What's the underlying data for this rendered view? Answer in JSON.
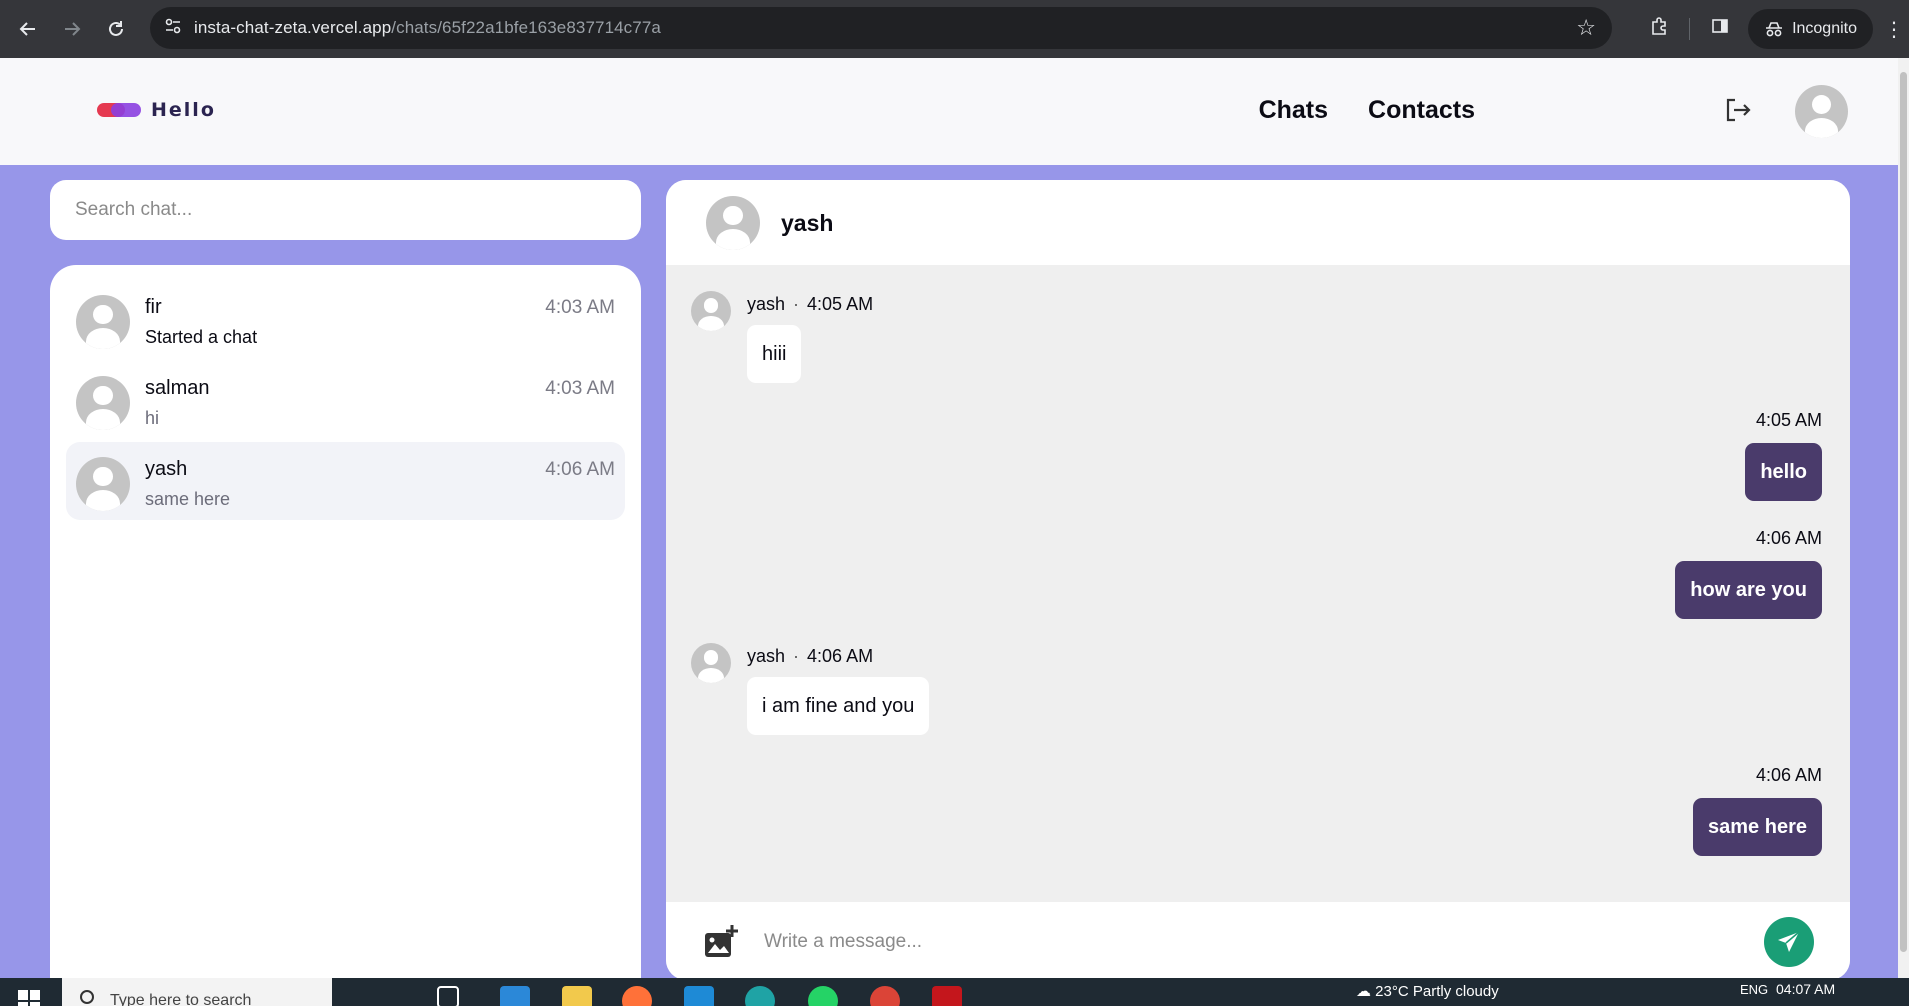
{
  "browser": {
    "url_host": "insta-chat-zeta.vercel.app",
    "url_path": "/chats/65f22a1bfe163e837714c77a",
    "incognito_label": "Incognito"
  },
  "header": {
    "logo_text": "Hello",
    "nav": [
      "Chats",
      "Contacts"
    ]
  },
  "sidebar": {
    "search_placeholder": "Search chat...",
    "chats": [
      {
        "name": "fir",
        "preview": "Started a chat",
        "time": "4:03 AM"
      },
      {
        "name": "salman",
        "preview": "hi",
        "time": "4:03 AM"
      },
      {
        "name": "yash",
        "preview": "same here",
        "time": "4:06 AM"
      }
    ]
  },
  "conversation": {
    "title": "yash",
    "messages": [
      {
        "sender": "yash",
        "time": "4:05 AM",
        "text": "hiii"
      },
      {
        "time": "4:05 AM",
        "text": "hello"
      },
      {
        "time": "4:06 AM",
        "text": "how are you"
      },
      {
        "sender": "yash",
        "time": "4:06 AM",
        "text": "i am fine and you"
      },
      {
        "time": "4:06 AM",
        "text": "same here"
      }
    ],
    "separator": "·",
    "composer_placeholder": "Write a message..."
  },
  "taskbar": {
    "search_placeholder": "Type here to search",
    "weather": "23°C  Partly cloudy",
    "lang": "ENG",
    "clock": "04:07 AM"
  },
  "colors": {
    "page_bg": "#9796e9",
    "sent_bubble": "#4a3b6b",
    "send_button": "#1a9e76"
  }
}
